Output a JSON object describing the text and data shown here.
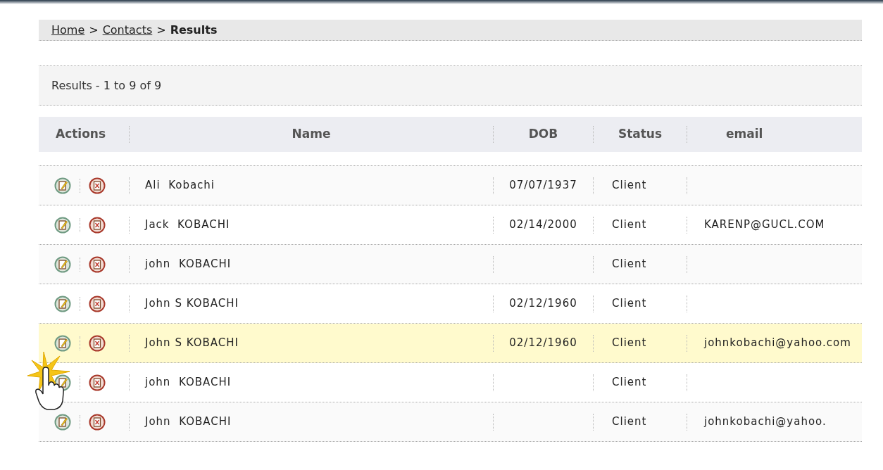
{
  "breadcrumb": [
    {
      "label": "Home",
      "kind": "link"
    },
    {
      "label": "Contacts",
      "kind": "link"
    },
    {
      "label": "Results",
      "kind": "current"
    }
  ],
  "breadcrumb_separator": ">",
  "results_summary": "Results - 1 to 9 of 9",
  "table": {
    "columns": [
      "Actions",
      "Name",
      "DOB",
      "Status",
      "email"
    ],
    "rows": [
      {
        "name": "Ali  Kobachi",
        "dob": "07/07/1937",
        "status": "Client",
        "selected": false
      },
      {
        "name": "Jack  KOBACHI",
        "dob": "02/14/2000",
        "status": "Client",
        "email": "KARENP@GUCL.COM",
        "selected": false
      },
      {
        "name": "john  KOBACHI",
        "status": "Client",
        "selected": false
      },
      {
        "name": "John S KOBACHI",
        "dob": "02/12/1960",
        "status": "Client",
        "selected": false
      },
      {
        "name": "John S KOBACHI",
        "dob": "02/12/1960",
        "status": "Client",
        "email": "johnkobachi@yahoo.com",
        "selected": true
      },
      {
        "name": "john  KOBACHI",
        "status": "Client",
        "selected": false
      },
      {
        "name": "John  KOBACHI",
        "status": "Client",
        "email": "johnkobachi@yahoo.",
        "selected": false
      }
    ]
  }
}
